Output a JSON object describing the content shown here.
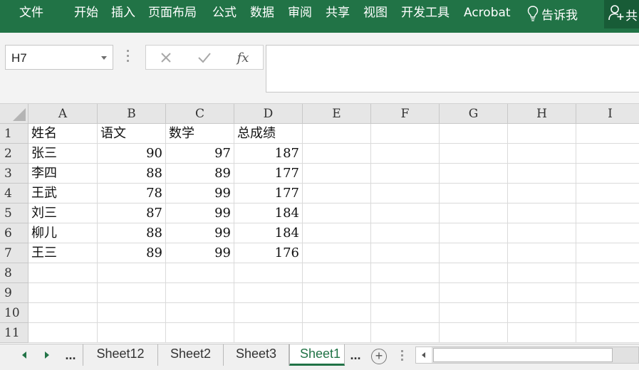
{
  "ribbon": {
    "tabs": [
      "文件",
      "开始",
      "插入",
      "页面布局",
      "公式",
      "数据",
      "审阅",
      "共享",
      "视图",
      "开发工具",
      "Acrobat"
    ],
    "tell_me": "告诉我",
    "share_label": "共"
  },
  "formula_bar": {
    "name_box": "H7",
    "fx_label": "fx",
    "formula_value": ""
  },
  "grid": {
    "columns": [
      "A",
      "B",
      "C",
      "D",
      "E",
      "F",
      "G",
      "H",
      "I"
    ],
    "row_numbers": [
      "1",
      "2",
      "3",
      "4",
      "5",
      "6",
      "7",
      "8",
      "9",
      "10",
      "11"
    ],
    "cells": [
      [
        "姓名",
        "语文",
        "数学",
        "总成绩"
      ],
      [
        "张三",
        "90",
        "97",
        "187"
      ],
      [
        "李四",
        "88",
        "89",
        "177"
      ],
      [
        "王武",
        "78",
        "99",
        "177"
      ],
      [
        "刘三",
        "87",
        "99",
        "184"
      ],
      [
        "柳儿",
        "88",
        "99",
        "184"
      ],
      [
        "王三",
        "89",
        "99",
        "176"
      ]
    ]
  },
  "sheet_tabs": {
    "overflow_left": "...",
    "tabs": [
      "Sheet12",
      "Sheet2",
      "Sheet3",
      "Sheet1"
    ],
    "active": "Sheet1",
    "overflow_right": "...",
    "add_label": "+"
  },
  "colors": {
    "ribbon": "#217346",
    "share_button": "#185c37",
    "active_tab_text": "#217346"
  },
  "icons": [
    "lightbulb-icon",
    "person-add-icon",
    "dropdown-arrow-icon",
    "cancel-icon",
    "enter-icon",
    "function-icon",
    "scroll-left-icon",
    "scroll-right-icon",
    "add-sheet-icon"
  ]
}
